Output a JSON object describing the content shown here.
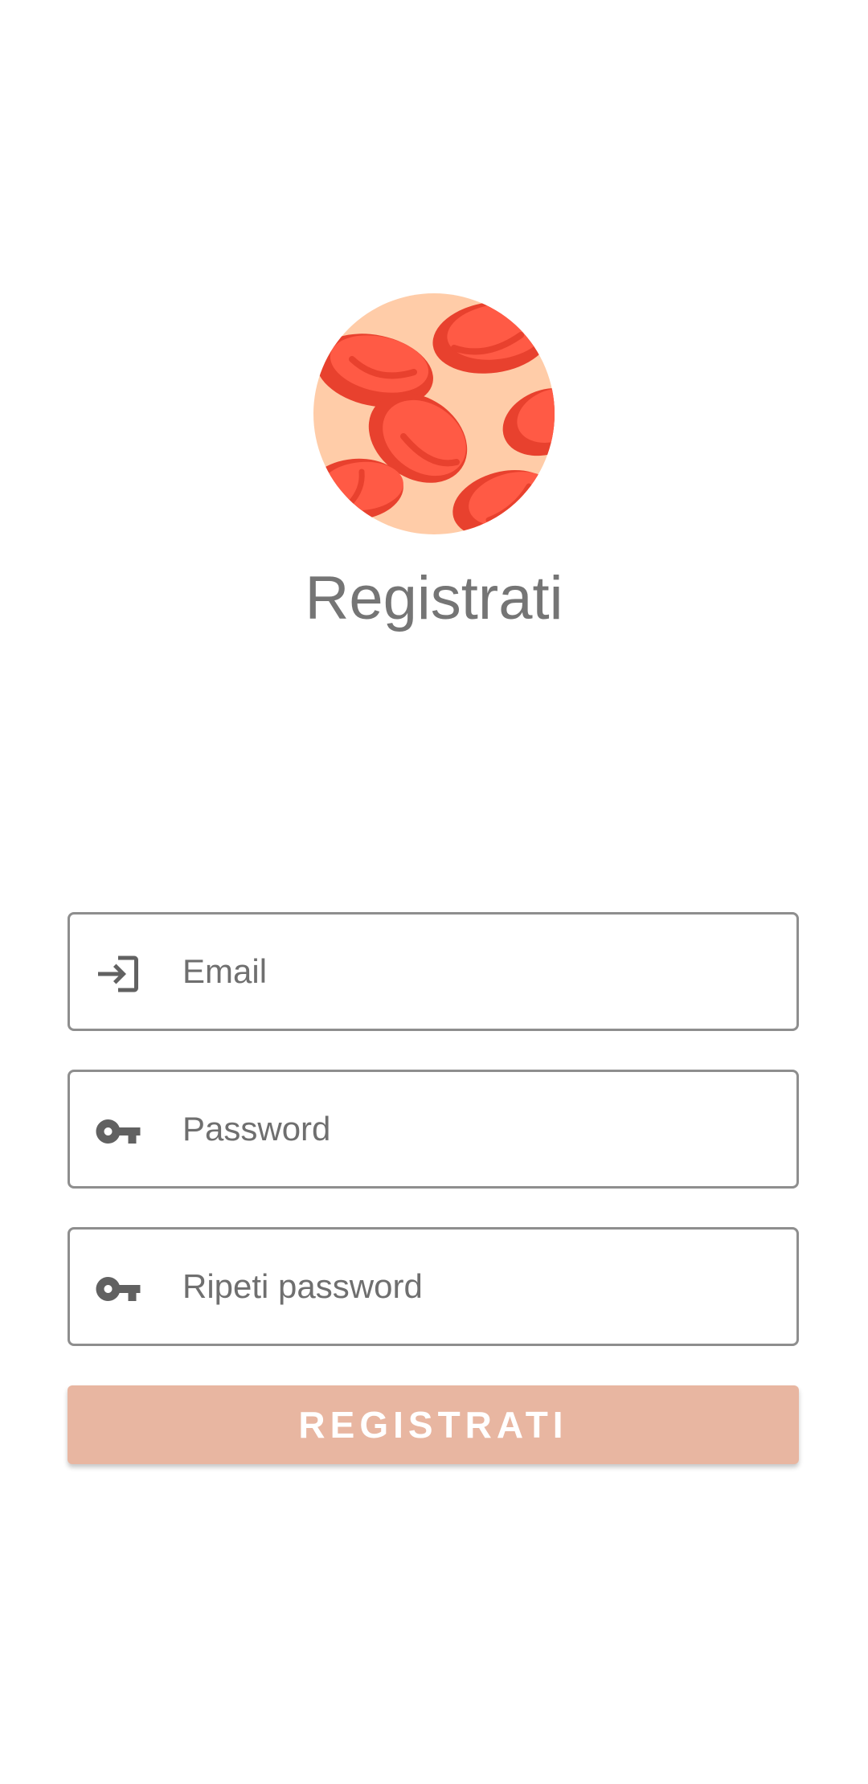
{
  "logo": {
    "icon": "red-blood-cells-logo",
    "background_color": "#ffcca8",
    "cell_color": "#ff5a45",
    "cell_shade_color": "#e8412e"
  },
  "header": {
    "title": "Registrati"
  },
  "form": {
    "email": {
      "icon": "login-icon",
      "value": "",
      "placeholder": "Email"
    },
    "password": {
      "icon": "key-icon",
      "value": "",
      "placeholder": "Password"
    },
    "repeat_password": {
      "icon": "key-icon",
      "value": "",
      "placeholder": "Ripeti password"
    },
    "submit_label": "REGISTRATI",
    "submit_color": "#e8b6a1"
  }
}
